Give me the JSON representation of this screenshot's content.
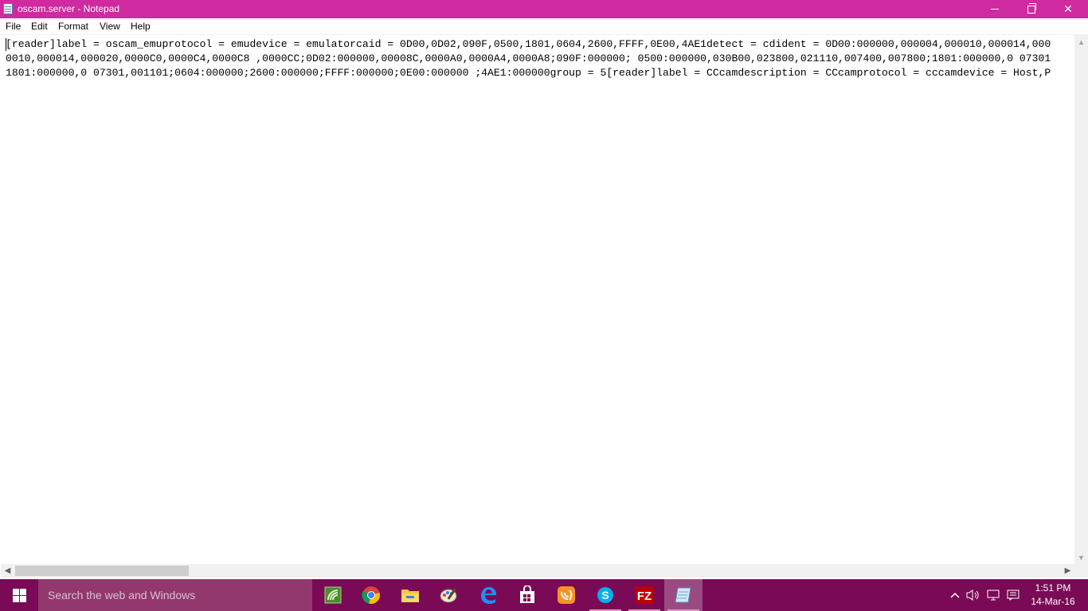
{
  "window": {
    "title": "oscam.server - Notepad"
  },
  "menu": {
    "items": [
      "File",
      "Edit",
      "Format",
      "View",
      "Help"
    ]
  },
  "editor": {
    "lines": [
      "[reader]label = oscam_emuprotocol = emudevice = emulatorcaid = 0D00,0D02,090F,0500,1801,0604,2600,FFFF,0E00,4AE1detect = cdident = 0D00:000000,000004,000010,000014,000",
      "0010,000014,000020,0000C0,0000C4,0000C8 ,0000CC;0D02:000000,00008C,0000A0,0000A4,0000A8;090F:000000; 0500:000000,030B00,023800,021110,007400,007800;1801:000000,0 07301",
      "1801:000000,0 07301,001101;0604:000000;2600:000000;FFFF:000000;0E00:000000 ;4AE1:000000group = 5[reader]label = CCcamdescription = CCcamprotocol = cccamdevice = Host,P"
    ]
  },
  "taskbar": {
    "search_placeholder": "Search the web and Windows",
    "apps": [
      "network-monitor-icon",
      "chrome-icon",
      "file-explorer-icon",
      "paint-icon",
      "edge-icon",
      "store-icon",
      "uc-browser-icon",
      "skype-icon",
      "filezilla-icon",
      "notepad-icon"
    ],
    "clock": {
      "time": "1:51 PM",
      "date": "14-Mar-16"
    }
  },
  "colors": {
    "titlebar": "#cf2a9f",
    "taskbar": "#7a0a55",
    "search_box": "#93386f"
  }
}
